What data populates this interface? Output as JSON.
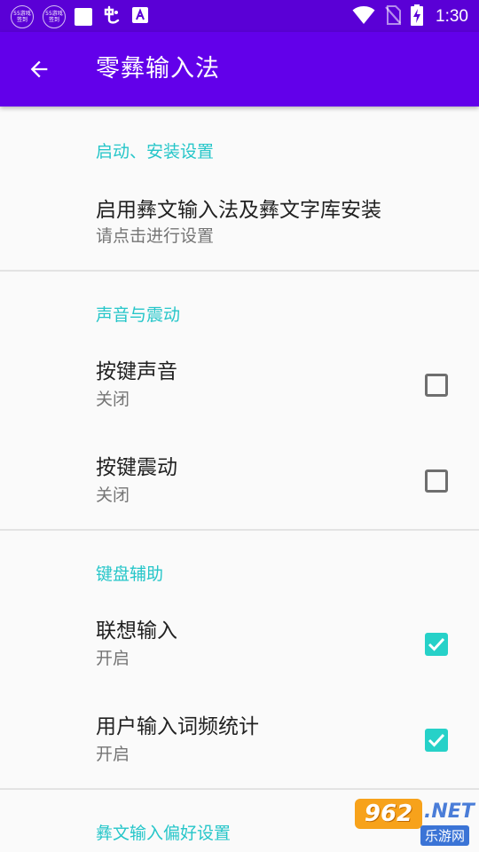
{
  "status_bar": {
    "badge1": {
      "line1": "55游戏",
      "line2": "签到"
    },
    "badge2": {
      "line1": "55游戏",
      "line2": "签到"
    },
    "time": "1:30"
  },
  "app_bar": {
    "title": "零彝输入法"
  },
  "sections": {
    "startup": {
      "category": "启动、安装设置",
      "items": [
        {
          "title": "启用彝文输入法及彝文字库安装",
          "summary": "请点击进行设置"
        }
      ]
    },
    "sound": {
      "category": "声音与震动",
      "items": [
        {
          "title": "按键声音",
          "summary": "关闭",
          "checked": false
        },
        {
          "title": "按键震动",
          "summary": "关闭",
          "checked": false
        }
      ]
    },
    "keyboard": {
      "category": "键盘辅助",
      "items": [
        {
          "title": "联想输入",
          "summary": "开启",
          "checked": true
        },
        {
          "title": "用户输入词频统计",
          "summary": "开启",
          "checked": true
        }
      ]
    },
    "preference": {
      "category": "彝文输入偏好设置"
    }
  },
  "watermark": {
    "logo": "962",
    "suffix": ".NET",
    "sub": "乐游网"
  },
  "colors": {
    "status_bar": "#5a00d6",
    "app_bar": "#6200ea",
    "accent": "#26c6c9",
    "checkbox_checked": "#26d1c8"
  }
}
